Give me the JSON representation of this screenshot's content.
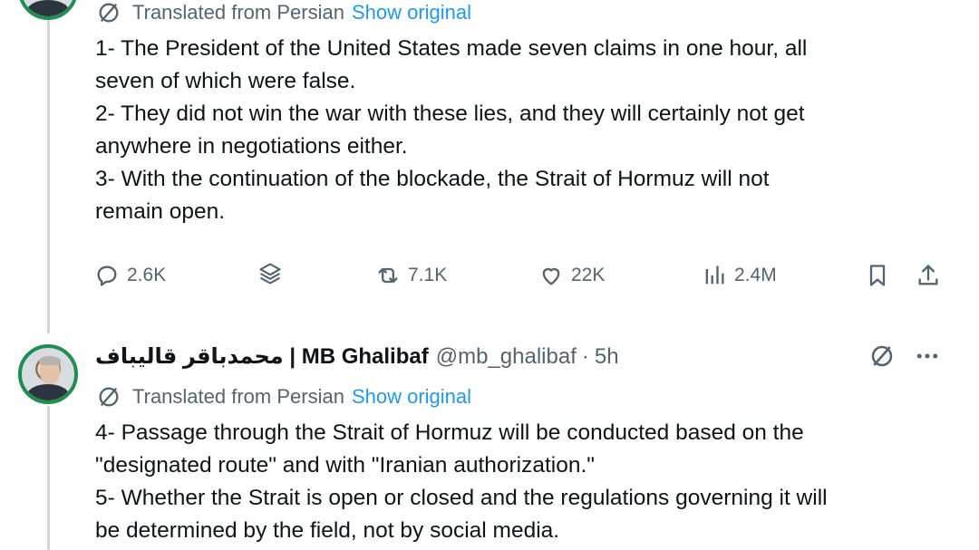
{
  "tweet1": {
    "translation": {
      "label": "Translated from Persian",
      "link": "Show original"
    },
    "lines": [
      "1- The President of the United States made seven claims in one hour, all",
      "seven of which were false.",
      "2- They did not win the war with these lies, and they will certainly not get",
      "anywhere in negotiations either.",
      "3- With the continuation of the blockade, the Strait of Hormuz will not",
      "remain open."
    ],
    "actions": {
      "replies": "2.6K",
      "reposts": "7.1K",
      "likes": "22K",
      "views": "2.4M"
    }
  },
  "tweet2": {
    "display_name": "محمدباقر قالیباف | MB Ghalibaf",
    "handle": "@mb_ghalibaf",
    "separator": "·",
    "time": "5h",
    "translation": {
      "label": "Translated from Persian",
      "link": "Show original"
    },
    "lines": [
      "4- Passage through the Strait of Hormuz will be conducted based on the",
      "\"designated route\" and with \"Iranian authorization.\"",
      "5- Whether the Strait is open or closed and the regulations governing it will",
      "be determined by the field, not by social media."
    ]
  },
  "icons": {
    "translate": "translate-icon",
    "reply": "reply-icon",
    "grok": "grok-icon",
    "repost": "repost-icon",
    "like": "heart-icon",
    "views": "views-icon",
    "bookmark": "bookmark-icon",
    "share": "share-icon",
    "more": "more-icon"
  },
  "colors": {
    "link": "#1d9bf0",
    "secondary_text": "#536471",
    "primary_text": "#0f1419",
    "thread_line": "#cfd9de",
    "avatar_ring": "#1e8f4e"
  }
}
